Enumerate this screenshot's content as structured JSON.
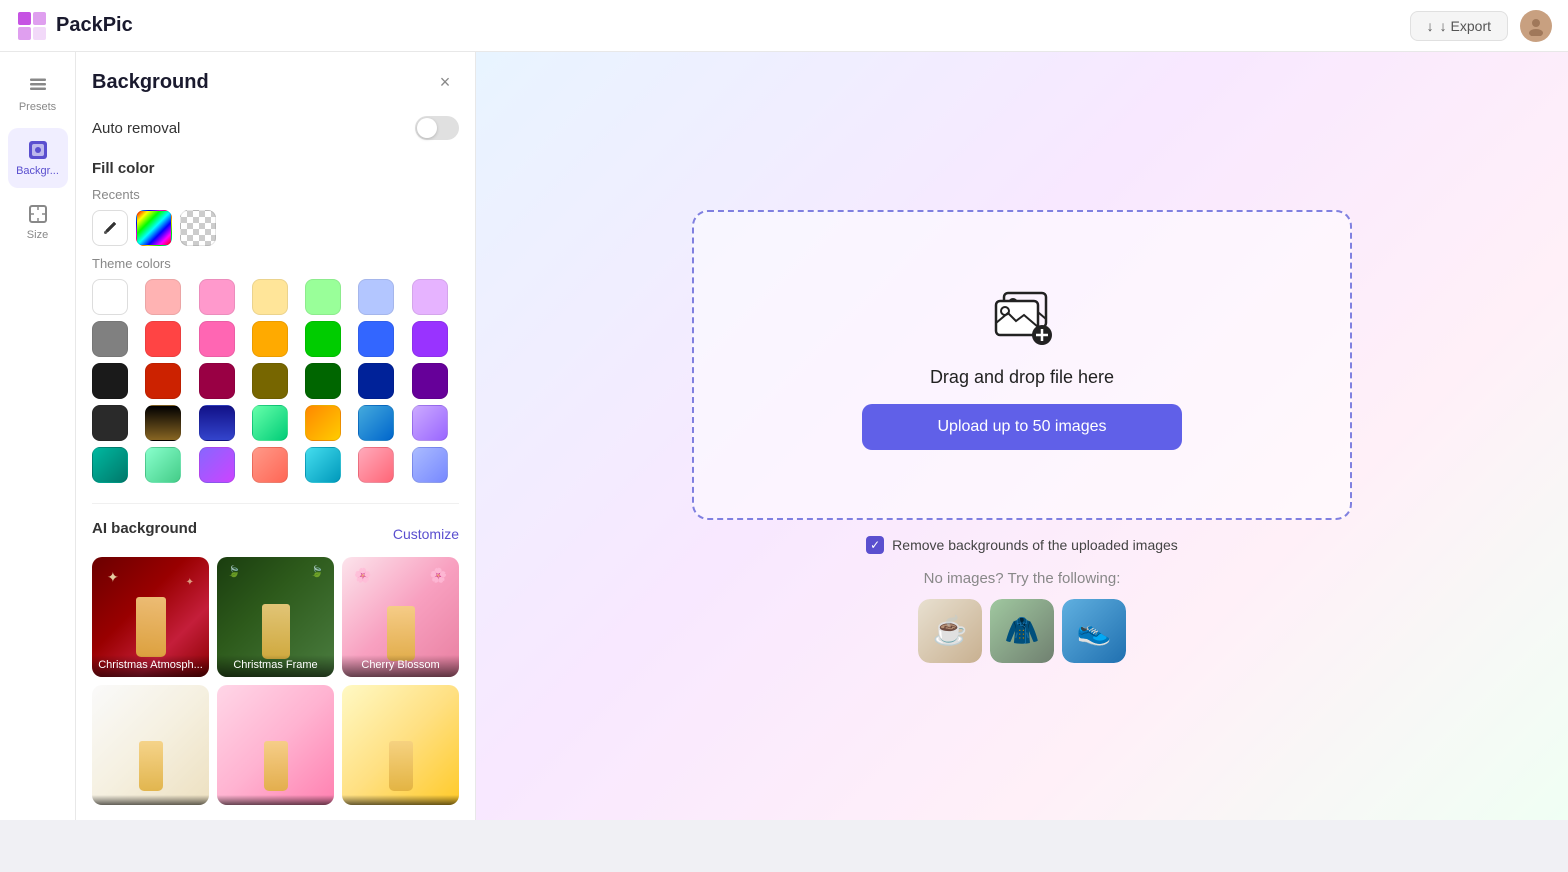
{
  "app": {
    "name": "PackPic",
    "logo_alt": "PackPic logo"
  },
  "header": {
    "export_label": "↓ Export",
    "avatar_char": "👤"
  },
  "sidebar": {
    "items": [
      {
        "id": "presets",
        "label": "Presets",
        "icon": "layers"
      },
      {
        "id": "background",
        "label": "Backgr...",
        "icon": "background",
        "active": true
      },
      {
        "id": "size",
        "label": "Size",
        "icon": "size"
      }
    ]
  },
  "panel": {
    "title": "Background",
    "close_label": "×",
    "auto_removal": {
      "label": "Auto removal",
      "enabled": false
    },
    "fill_color": {
      "section_title": "Fill color",
      "recents_label": "Recents",
      "theme_colors_label": "Theme colors"
    },
    "ai_background": {
      "section_title": "AI background",
      "customize_label": "Customize",
      "items": [
        {
          "id": "christmas-atm",
          "label": "Christmas Atmosph...",
          "style": "christmas-atm"
        },
        {
          "id": "christmas-frame",
          "label": "Christmas Frame",
          "style": "christmas-frame"
        },
        {
          "id": "cherry-blossom",
          "label": "Cherry Blossom",
          "style": "cherry-blossom"
        },
        {
          "id": "white-flowers",
          "label": "",
          "style": "white-flowers"
        },
        {
          "id": "pink-flowers",
          "label": "",
          "style": "pink-flowers"
        },
        {
          "id": "yellow-flowers",
          "label": "",
          "style": "yellow-flowers"
        }
      ]
    },
    "theme_colors": [
      "#ffffff",
      "#ffb3b3",
      "#ff99cc",
      "#ffe599",
      "#99ff99",
      "#b3c6ff",
      "#e6b3ff",
      "#808080",
      "#ff4444",
      "#ff66b3",
      "#ffaa00",
      "#00cc00",
      "#3366ff",
      "#9933ff",
      "#1a1a1a",
      "#cc2200",
      "#990044",
      "#776600",
      "#006600",
      "#002299",
      "#660099",
      "#333333",
      "#886622",
      "#1a1a99",
      "#66ffaa",
      "#ff8800",
      "#44aadd",
      "#ccaaff"
    ],
    "gradient_colors": [
      "#000000",
      "linear-gradient(180deg,#000,#886622)",
      "linear-gradient(180deg,#111188,#3344cc)",
      "linear-gradient(135deg,#66ffaa,#00cc77)",
      "linear-gradient(135deg,#ff8800,#ffcc00)",
      "linear-gradient(135deg,#44aadd,#0066cc)",
      "linear-gradient(135deg,#ccaaff,#9966ff)"
    ]
  },
  "canvas": {
    "upload_zone": {
      "drag_text": "Drag and drop file here",
      "upload_btn_label": "Upload up to 50 images",
      "checkbox_label": "Remove backgrounds of the uploaded images",
      "no_images_text": "No images? Try the following:"
    }
  }
}
